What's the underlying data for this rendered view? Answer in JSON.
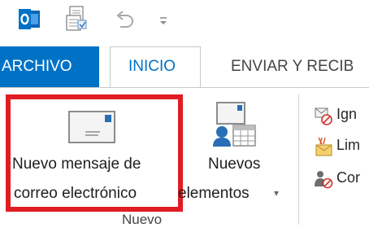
{
  "quick_access": {
    "app_icon": "outlook-app-icon",
    "send_receive_icon": "send-receive-all-icon",
    "undo_icon": "undo-icon",
    "customize_icon": "customize-quick-access-icon"
  },
  "tabs": [
    {
      "label": "ARCHIVO",
      "active": false
    },
    {
      "label": "INICIO",
      "active": true
    },
    {
      "label": "ENVIAR Y RECIB"
    }
  ],
  "ribbon": {
    "new_email": {
      "label_line1": "Nuevo mensaje de",
      "label_line2": "correo electrónico",
      "icon": "envelope-icon"
    },
    "new_items": {
      "label_line1": "Nuevos",
      "label_line2": "elementos",
      "icon": "new-items-icon",
      "dropdown_glyph": "▾"
    },
    "group_label": "Nuevo",
    "delete_group": [
      {
        "label": "Ign",
        "icon": "ignore-icon"
      },
      {
        "label": "Lim",
        "icon": "clean-up-icon"
      },
      {
        "label": "Cor",
        "icon": "junk-icon"
      }
    ]
  },
  "colors": {
    "archivo_bg": "#0072c6",
    "active_tab_text": "#0072c6",
    "highlight_border": "#e11d24"
  }
}
